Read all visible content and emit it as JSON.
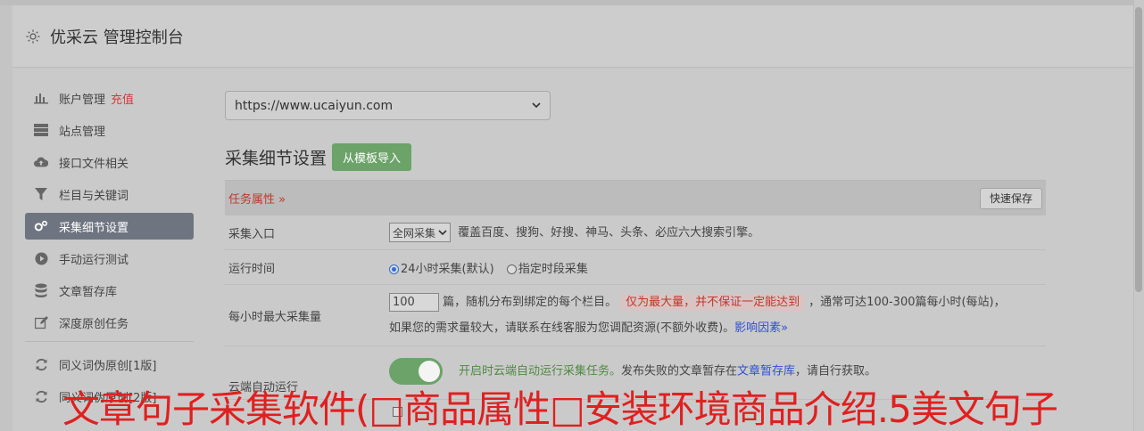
{
  "header": {
    "title": "优采云 管理控制台"
  },
  "sidebar": {
    "items": [
      {
        "label": "账户管理",
        "badge": "充值",
        "icon": "bar-chart-icon"
      },
      {
        "label": "站点管理",
        "icon": "server-icon"
      },
      {
        "label": "接口文件相关",
        "icon": "cloud-upload-icon"
      },
      {
        "label": "栏目与关键词",
        "icon": "filter-icon"
      },
      {
        "label": "采集细节设置",
        "icon": "gears-icon",
        "active": true
      },
      {
        "label": "手动运行测试",
        "icon": "play-circle-icon"
      },
      {
        "label": "文章暂存库",
        "icon": "database-icon"
      },
      {
        "label": "深度原创任务",
        "icon": "edit-icon"
      },
      {
        "label": "同义词伪原创[1版]",
        "icon": "refresh-icon"
      },
      {
        "label": "同义词伪原创[2版]",
        "icon": "refresh-icon"
      }
    ]
  },
  "main": {
    "site_select": "https://www.ucaiyun.com",
    "section_title": "采集细节设置",
    "import_button": "从模板导入",
    "task_attr": "任务属性 »",
    "quick_save": "快速保存",
    "rows": {
      "entry": {
        "label": "采集入口",
        "select": "全网采集",
        "desc": "覆盖百度、搜狗、好搜、神马、头条、必应六大搜索引擎。"
      },
      "runtime": {
        "label": "运行时间",
        "opt1": "24小时采集(默认)",
        "opt2": "指定时段采集"
      },
      "max_per_hour": {
        "label": "每小时最大采集量",
        "value": "100",
        "text1": "篇，随机分布到绑定的每个栏目。",
        "warn": "仅为最大量，并不保证一定能达到",
        "text2": "，通常可达100-300篇每小时(每站)，",
        "text3": "如果您的需求量较大，请联系在线客服为您调配资源(不额外收费)。",
        "link": "影响因素»"
      },
      "cloud": {
        "label": "云端自动运行",
        "text_green": "开启时云端自动运行采集任务。",
        "text1": "发布失败的文章暂存在",
        "link": "文章暂存库",
        "text2": "，请自行获取。"
      }
    }
  },
  "overlay_text": "文章句子采集软件(□商品属性□安装环境商品介绍.5美文句子"
}
